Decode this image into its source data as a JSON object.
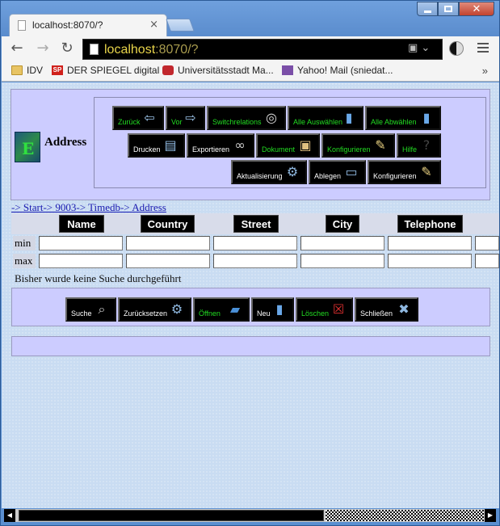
{
  "browser": {
    "tab_title": "localhost:8070/?",
    "url_host": "localhost",
    "url_rest": ":8070/?",
    "bookmarks": [
      "IDV",
      "DER SPIEGEL digital",
      "Universitätsstadt Ma...",
      "Yahoo! Mail (sniedat..."
    ],
    "spiegel_badge": "SP",
    "bookmarks_more": "»"
  },
  "app": {
    "title": "Address",
    "logo_letter": "E",
    "toolbar_row1": [
      "Zurück",
      "Vor",
      "Switchrelations",
      "Alle Auswählen",
      "Alle Abwählen"
    ],
    "toolbar_row2": [
      "Drucken",
      "Exportieren",
      "Dokument",
      "Konfigurieren",
      "Hilfe"
    ],
    "toolbar_row3": [
      "Aktualisierung",
      "Ablegen",
      "Konfigurieren"
    ],
    "breadcrumb": [
      "-> Start",
      "-> 9003",
      "-> Timedb",
      "-> Address"
    ],
    "columns": [
      "Name",
      "Country",
      "Street",
      "City",
      "Telephone"
    ],
    "row_min": "min",
    "row_max": "max",
    "status": "Bisher wurde keine Suche durchgeführt",
    "actions": [
      "Suche",
      "Zurücksetzen",
      "Öffnen",
      "Neu",
      "Löschen",
      "Schließen"
    ]
  },
  "colors": {
    "panel": "#ccccff",
    "button_bg": "#000000",
    "green_label": "#22dd22",
    "link": "#1a1ab0"
  }
}
